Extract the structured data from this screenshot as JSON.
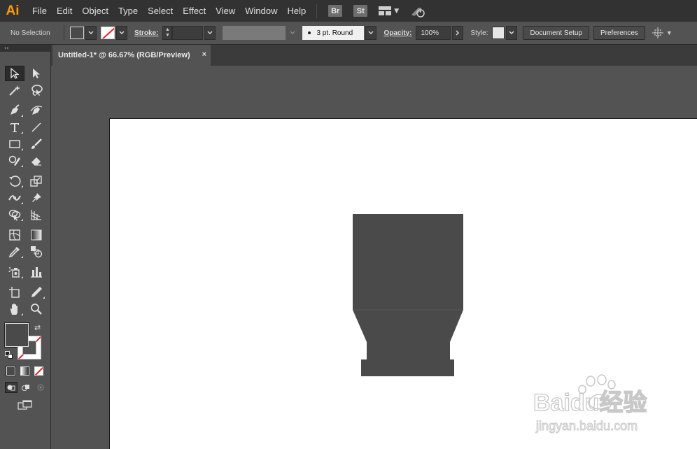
{
  "app": {
    "logo": "Ai",
    "accent": "#ff9a00"
  },
  "menu": {
    "items": [
      "File",
      "Edit",
      "Object",
      "Type",
      "Select",
      "Effect",
      "View",
      "Window",
      "Help"
    ],
    "bridge_label": "Br",
    "stock_label": "St"
  },
  "control_bar": {
    "selection_status": "No Selection",
    "stroke_label": "Stroke:",
    "brush_value": "3 pt. Round",
    "opacity_label": "Opacity:",
    "opacity_value": "100%",
    "style_label": "Style:",
    "document_setup_label": "Document Setup",
    "preferences_label": "Preferences"
  },
  "document": {
    "tab_title": "Untitled-1* @ 66.67% (RGB/Preview)",
    "close_glyph": "×"
  },
  "tools": [
    "selection-tool",
    "direct-selection-tool",
    "magic-wand-tool",
    "lasso-tool",
    "pen-tool",
    "curvature-tool",
    "type-tool",
    "line-segment-tool",
    "rectangle-tool",
    "paintbrush-tool",
    "shaper-tool",
    "eraser-tool",
    "rotate-tool",
    "scale-tool",
    "width-tool",
    "puppet-warp-tool",
    "shape-builder-tool",
    "perspective-grid-tool",
    "mesh-tool",
    "gradient-tool",
    "eyedropper-tool",
    "blend-tool",
    "symbol-sprayer-tool",
    "column-graph-tool",
    "artboard-tool",
    "slice-tool",
    "hand-tool",
    "zoom-tool"
  ],
  "colors": {
    "fill": "#4a4a4a",
    "stroke": "none",
    "artwork": "#4a4a4a"
  },
  "watermark": {
    "brand": "Baidu经验",
    "url": "jingyan.baidu.com"
  }
}
